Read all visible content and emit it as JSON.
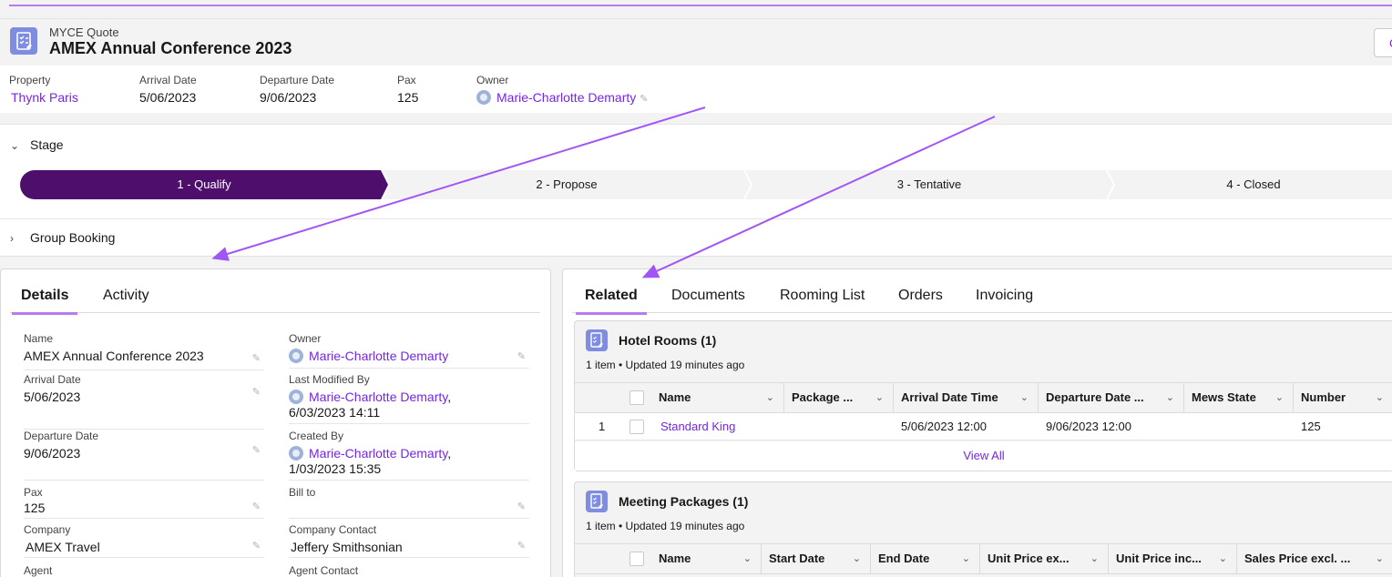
{
  "header": {
    "record_type": "MYCE Quote",
    "title": "AMEX Annual Conference 2023",
    "button_label": "C",
    "record_icon": "clipboard-check-icon"
  },
  "highlights": [
    {
      "label": "Property",
      "value": "Thynk Paris",
      "link": true
    },
    {
      "label": "Arrival Date",
      "value": "5/06/2023",
      "link": false
    },
    {
      "label": "Departure Date",
      "value": "9/06/2023",
      "link": false
    },
    {
      "label": "Pax",
      "value": "125",
      "link": false
    },
    {
      "label": "Owner",
      "value": "Marie-Charlotte Demarty",
      "link": true
    }
  ],
  "stage": {
    "label": "Stage",
    "steps": [
      "1 - Qualify",
      "2 - Propose",
      "3 - Tentative",
      "4 - Closed"
    ],
    "active_index": 0,
    "active_color": "#4d0f6b"
  },
  "group_booking": {
    "label": "Group Booking"
  },
  "left_tabs": [
    "Details",
    "Activity"
  ],
  "details": {
    "left": [
      {
        "label": "Name",
        "value": "AMEX Annual Conference 2023"
      },
      {
        "label": "Arrival Date",
        "value": "5/06/2023"
      },
      {
        "label": "Departure Date",
        "value": "9/06/2023"
      },
      {
        "label": "Pax",
        "value": "125"
      },
      {
        "label": "Company",
        "value": "AMEX Travel"
      },
      {
        "label": "Agent",
        "value": ""
      }
    ],
    "right": [
      {
        "label": "Owner",
        "value": "Marie-Charlotte Demarty"
      },
      {
        "label": "Last Modified By",
        "value": "Marie-Charlotte Demarty",
        "date": "6/03/2023 14:11"
      },
      {
        "label": "Created By",
        "value": "Marie-Charlotte Demarty",
        "date": "1/03/2023 15:35"
      },
      {
        "label": "Bill to",
        "value": ""
      },
      {
        "label": "Company Contact",
        "value": "Jeffery Smithsonian"
      },
      {
        "label": "Agent Contact",
        "value": ""
      }
    ],
    "comma": ","
  },
  "right_tabs": [
    "Related",
    "Documents",
    "Rooming List",
    "Orders",
    "Invoicing"
  ],
  "hotel_rooms": {
    "title": "Hotel Rooms (1)",
    "meta": "1 item • Updated 19 minutes ago",
    "columns": [
      "Name",
      "Package ...",
      "Arrival Date Time",
      "Departure Date ...",
      "Mews State",
      "Number"
    ],
    "rows": [
      {
        "num": "1",
        "name": "Standard King",
        "package": "",
        "arrival": "5/06/2023 12:00",
        "departure": "9/06/2023 12:00",
        "mews": "",
        "number": "125"
      }
    ],
    "view_all": "View All"
  },
  "meeting_packages": {
    "title": "Meeting Packages (1)",
    "meta": "1 item • Updated 19 minutes ago",
    "columns": [
      "Name",
      "Start Date",
      "End Date",
      "Unit Price ex...",
      "Unit Price inc...",
      "Sales Price excl. ..."
    ]
  },
  "colors": {
    "link": "#7526e3",
    "accent": "#b77af0",
    "arrow": "#a155f5",
    "icon_bg": "#7f8de1"
  }
}
